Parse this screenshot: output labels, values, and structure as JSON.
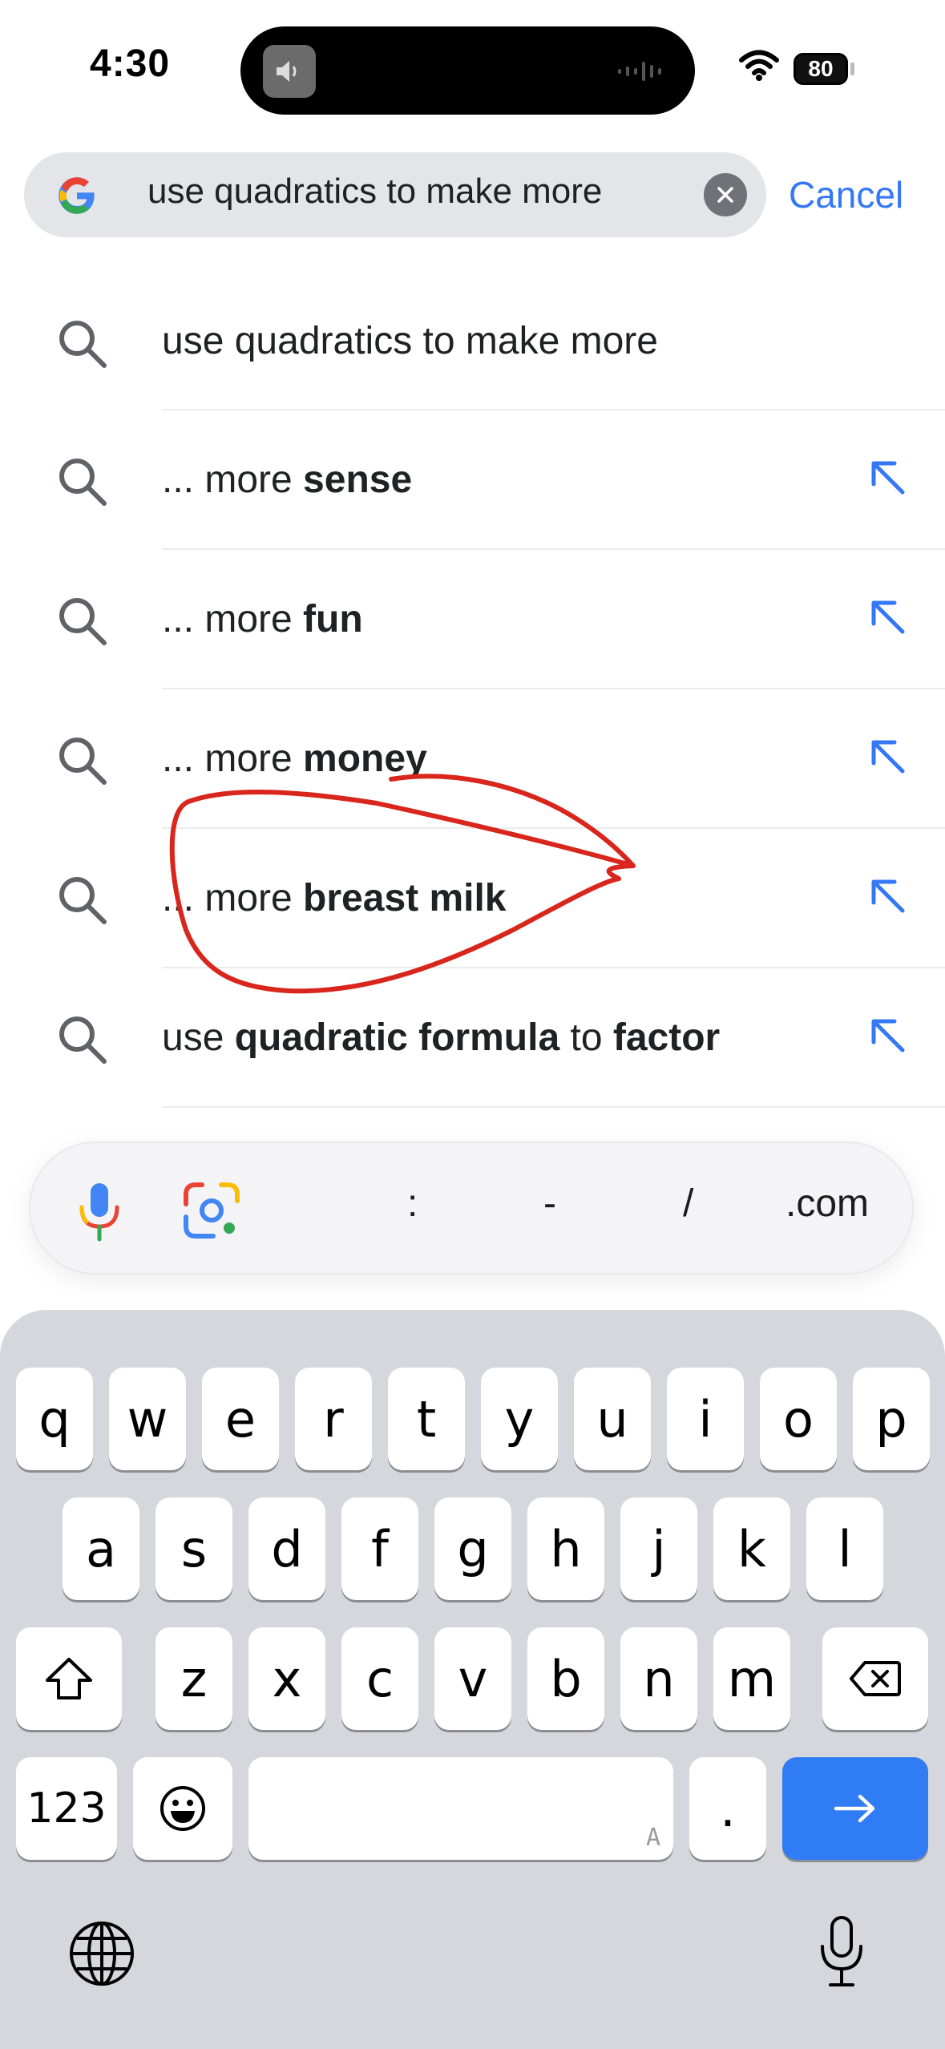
{
  "status": {
    "time": "4:30",
    "battery": "80"
  },
  "search": {
    "query": "use quadratics to make more",
    "cancel_label": "Cancel"
  },
  "suggestions": [
    {
      "plain": "use quadratics to make more",
      "bold": "",
      "has_arrow": false
    },
    {
      "plain": "... more ",
      "bold": "sense",
      "has_arrow": true
    },
    {
      "plain": "... more ",
      "bold": "fun",
      "has_arrow": true
    },
    {
      "plain": "... more ",
      "bold": "money",
      "has_arrow": true
    },
    {
      "plain": "... more ",
      "bold": "breast milk",
      "has_arrow": true
    },
    {
      "parts": [
        "use ",
        "quadratic formula",
        " to ",
        "factor"
      ],
      "has_arrow": true
    }
  ],
  "accessory": {
    "keys": [
      ":",
      "-",
      "/",
      ".com"
    ]
  },
  "keyboard": {
    "row1": [
      "q",
      "w",
      "e",
      "r",
      "t",
      "y",
      "u",
      "i",
      "o",
      "p"
    ],
    "row2": [
      "a",
      "s",
      "d",
      "f",
      "g",
      "h",
      "j",
      "k",
      "l"
    ],
    "row3": [
      "z",
      "x",
      "c",
      "v",
      "b",
      "n",
      "m"
    ],
    "numbers_label": "123",
    "period_label": ".",
    "space_hint": "A"
  },
  "annotation_color": "#d9261c",
  "accent_color": "#3478f6"
}
